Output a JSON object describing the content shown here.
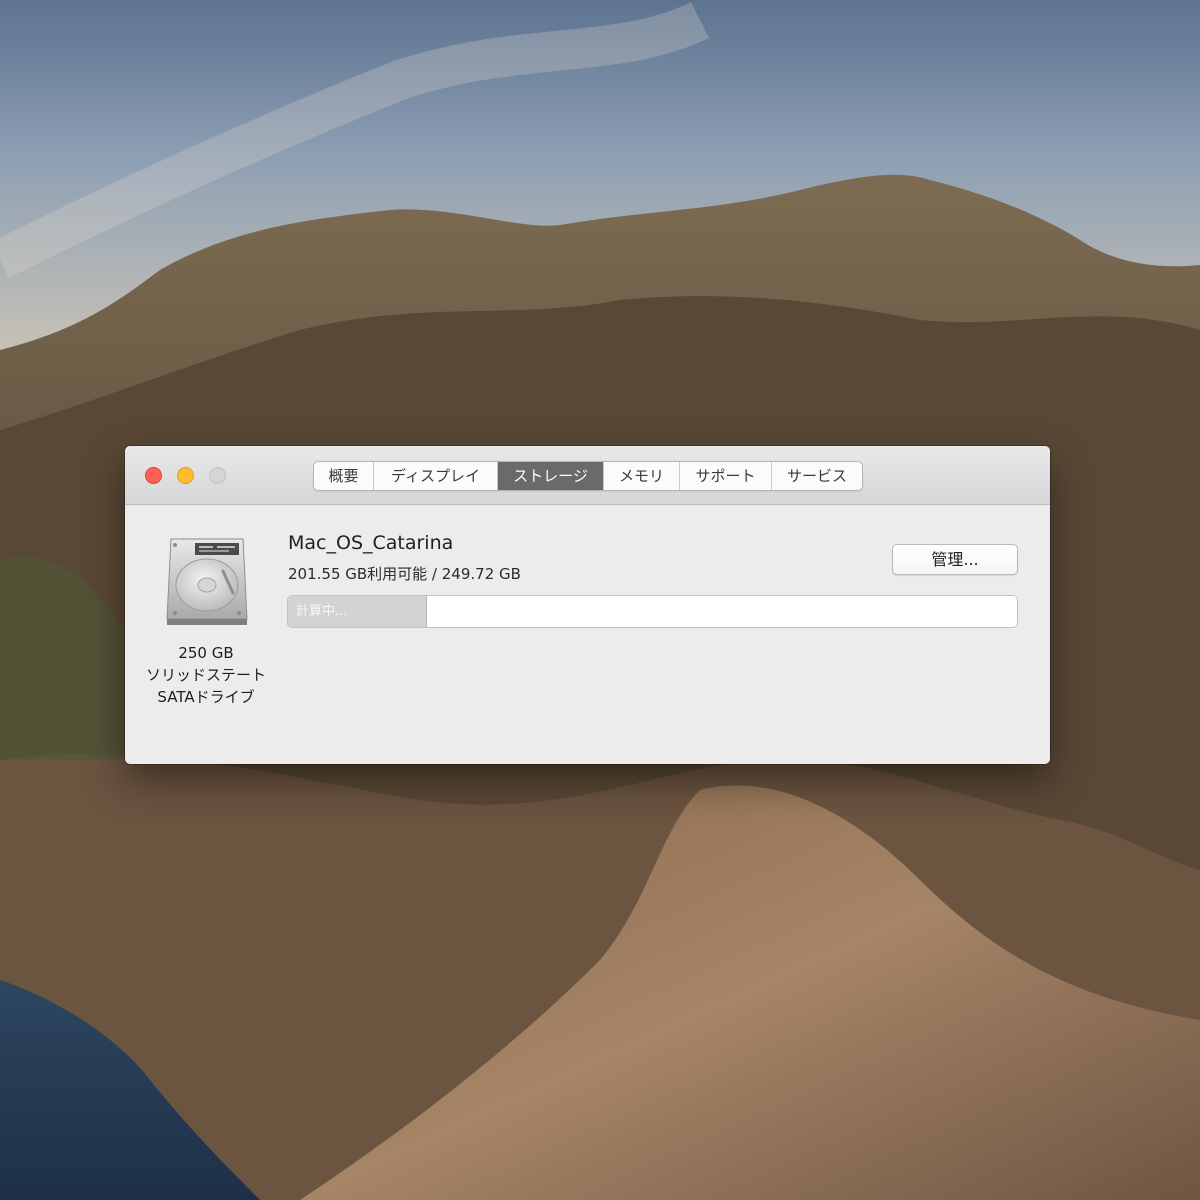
{
  "window": {
    "tabs": [
      {
        "label": "概要"
      },
      {
        "label": "ディスプレイ"
      },
      {
        "label": "ストレージ"
      },
      {
        "label": "メモリ"
      },
      {
        "label": "サポート"
      },
      {
        "label": "サービス"
      }
    ],
    "active_tab": "ストレージ"
  },
  "drive": {
    "icon": "hard-drive-icon",
    "capacity": "250 GB",
    "type_line1": "ソリッドステート",
    "type_line2": "SATAドライブ"
  },
  "volume": {
    "name": "Mac_OS_Catarina",
    "size_text": "201.55 GB利用可能 / 249.72 GB",
    "manage_label": "管理...",
    "bar_label": "計算中...",
    "bar_fill_fraction": 0.19
  },
  "colors": {
    "close": "#fe5f57",
    "minimize": "#febc2e",
    "zoom": "#d5d5d5",
    "active_tab": "#6a6a6a"
  }
}
